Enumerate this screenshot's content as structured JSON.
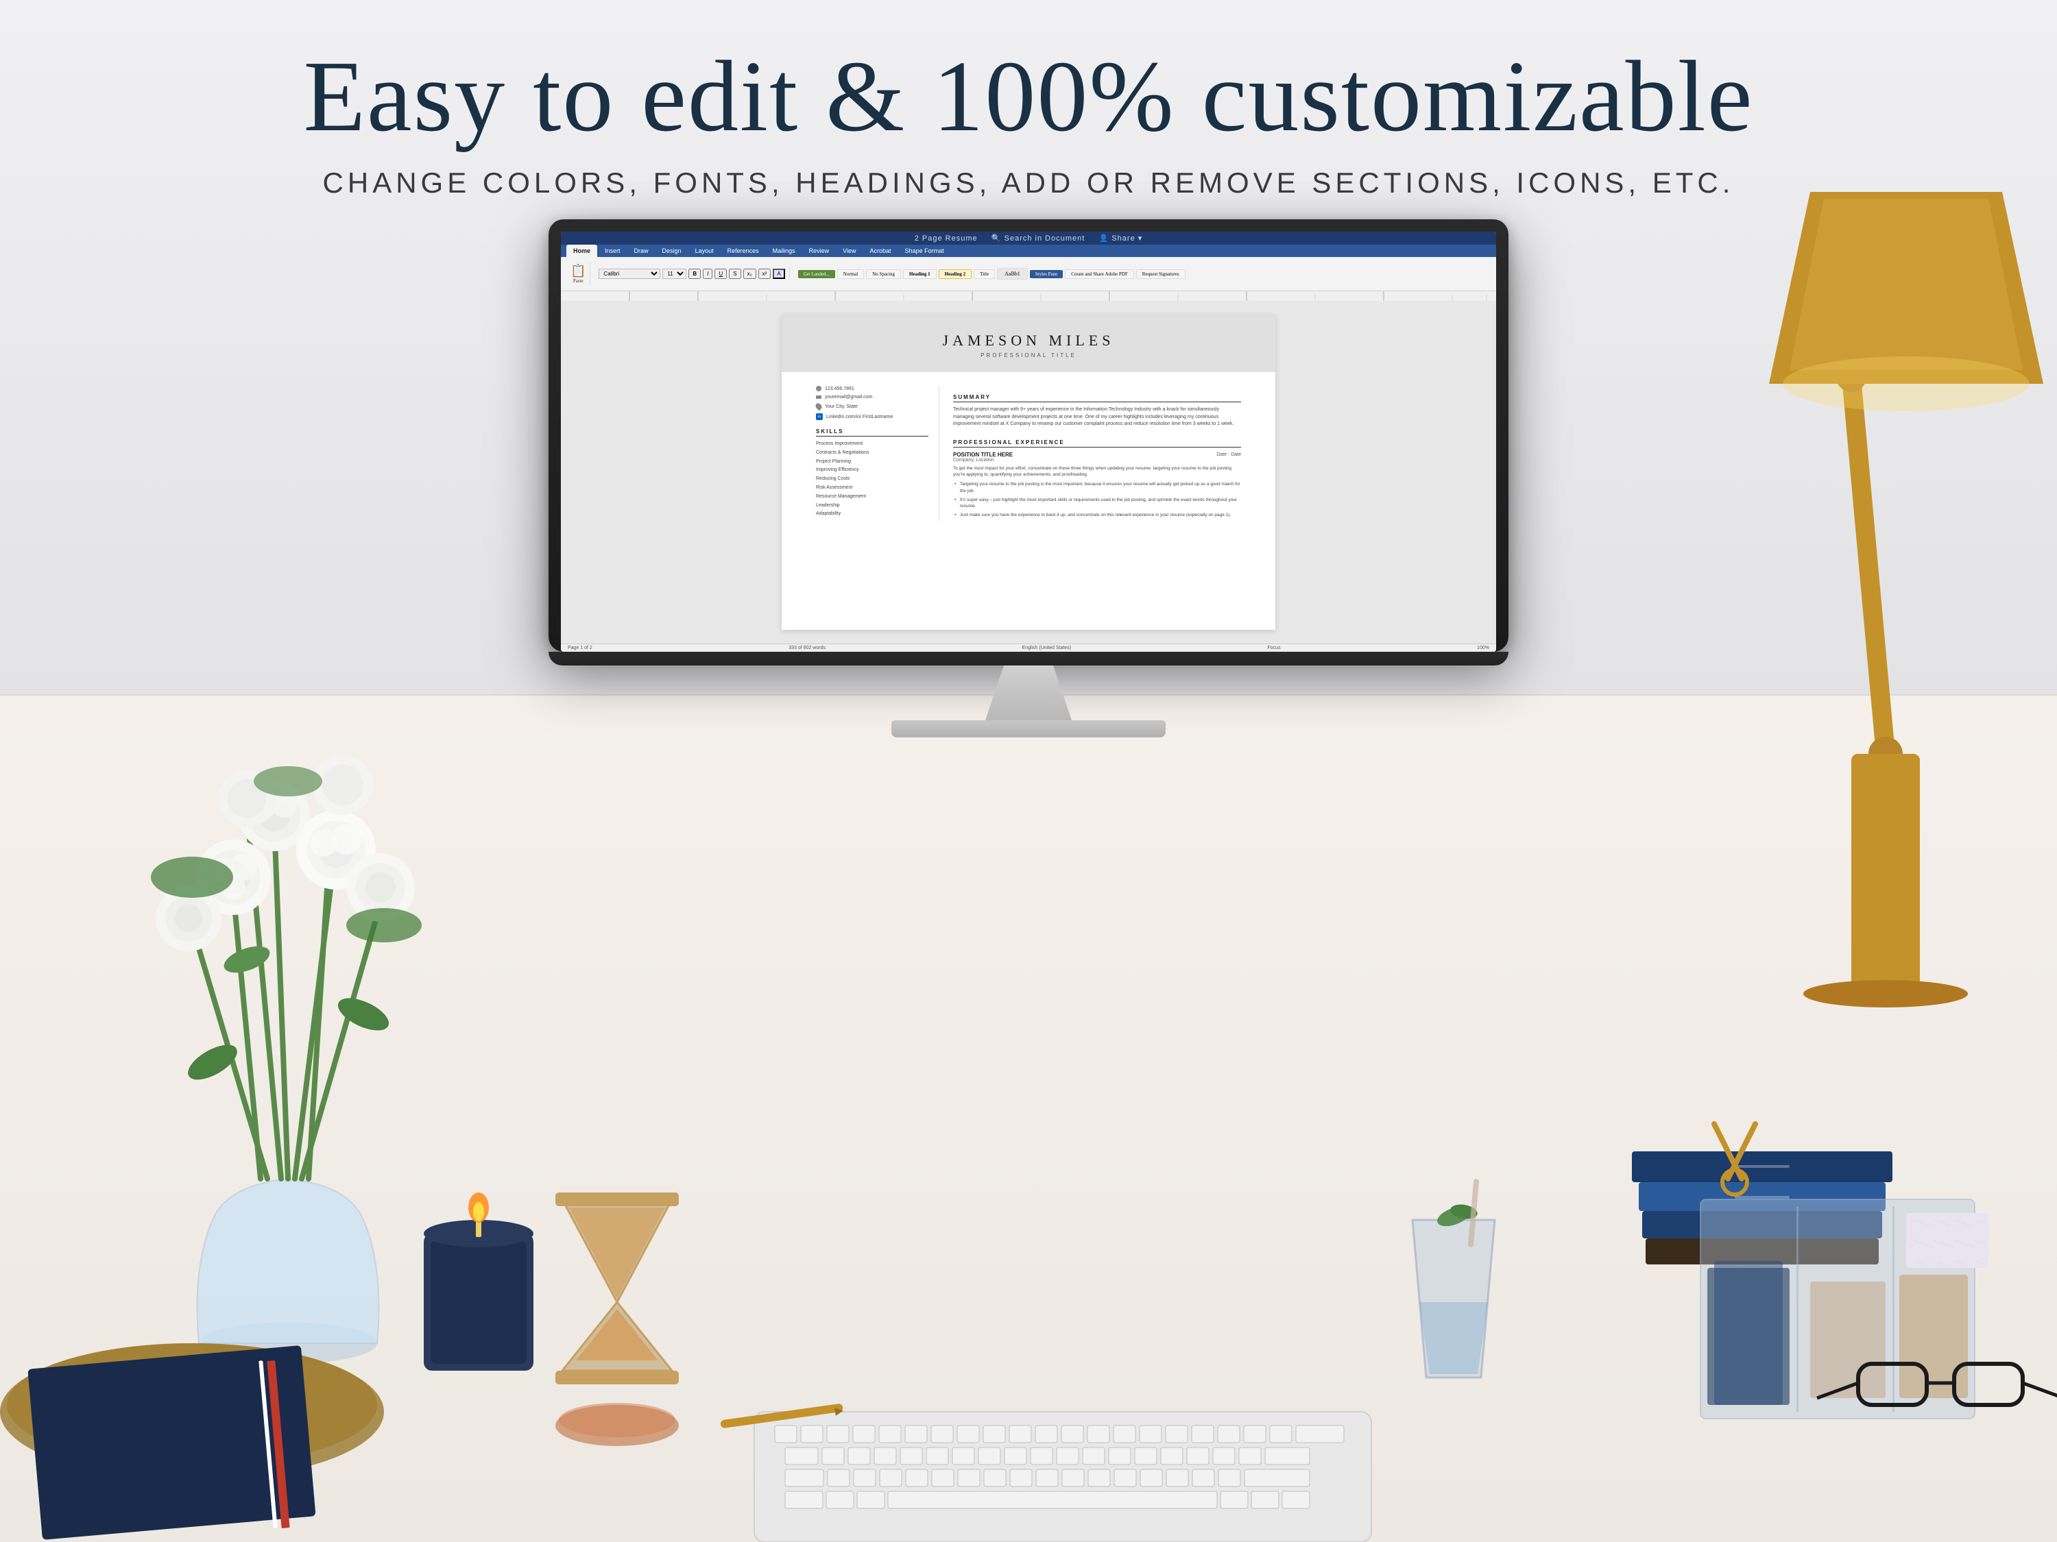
{
  "header": {
    "main_title": "Easy to edit & 100% customizable",
    "subtitle": "CHANGE COLORS, FONTS, HEADINGS, ADD or REMOVE SECTIONS, ICONS, etc."
  },
  "document": {
    "name": "JAMESON MILES",
    "professional_title": "PROFESSIONAL TITLE",
    "contact": {
      "phone": "123.456.7891",
      "email": "youremail@gmail.com",
      "location": "Your City, State",
      "linkedin": "LinkedIn.com/in/ FirstLastname"
    },
    "sections": {
      "summary_label": "SUMMARY",
      "summary_text": "Technical project manager with 9+ years of experience in the Information Technology Industry with a knack for simultaneously managing several software development projects at one time. One of my career highlights includes leveraging my continuous improvement mindset at X Company to revamp our customer complaint process and reduce resolution time from 3 weeks to 1 week.",
      "skills_label": "SKILLS",
      "skills": [
        "Process Improvement",
        "Contracts & Negotiations",
        "Project Planning",
        "Improving Efficiency",
        "Reducing Costs",
        "Risk Assessment",
        "Resource Management",
        "Leadership",
        "Adaptability"
      ],
      "experience_label": "PROFESSIONAL EXPERIENCE",
      "position_title": "POSITION TITLE HERE",
      "company": "Company, Location",
      "date": "Date - Date",
      "job_description": "To get the most impact for your effort, concentrate on these three things when updating your resume: targeting your resume to the job posting you're applying to, quantifying your achievements, and proofreading.",
      "bullets": [
        "Targeting your resume to the job posting is the most important, because it ensures your resume will actually get picked up as a good match for the job.",
        "It's super easy – just highlight the most important skills or requirements used in the job posting, and sprinkle the exact words throughout your resume.",
        "Just make sure you have the experience to back it up, and concentrate on this relevant experience in your resume (especially on page 1)."
      ]
    }
  },
  "word_ui": {
    "title": "2 Page Resume",
    "tabs": [
      "Home",
      "Insert",
      "Draw",
      "Design",
      "Layout",
      "References",
      "Mailings",
      "Review",
      "View",
      "Acrobat",
      "Shape Format"
    ],
    "active_tab": "Home",
    "share_btn": "Share",
    "status_bar": "Page 1 of 2    333 of 802 words    English (United States)    Focus    100%"
  },
  "heading_label": {
    "text": "Heading 2",
    "tooltip": "?"
  },
  "colors": {
    "background": "#e8e8ea",
    "desk": "#f0ebe4",
    "monitor_frame": "#1a1a1a",
    "title_color": "#1a3044",
    "accent_gold": "#c4922a",
    "navy": "#1a2a4a",
    "doc_header_bg": "#e0e0e0"
  }
}
